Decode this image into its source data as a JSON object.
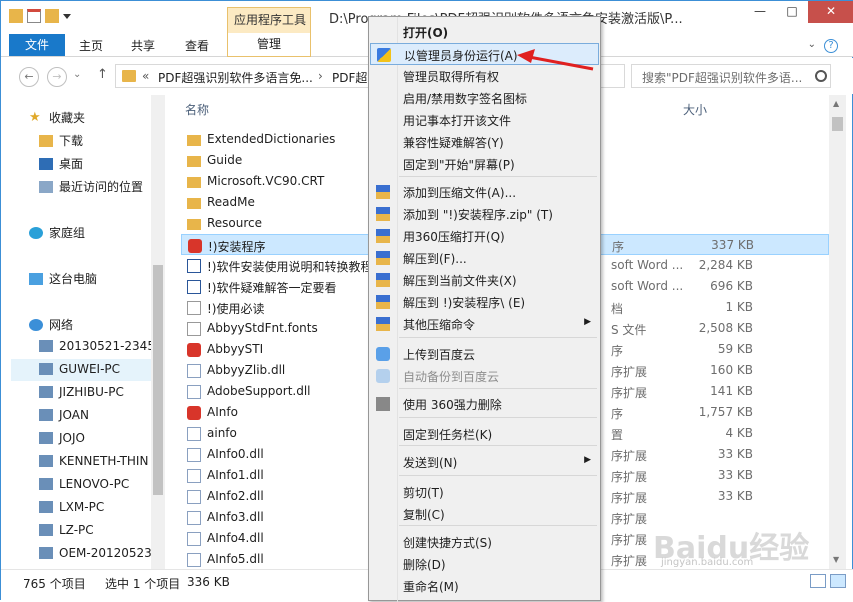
{
  "window": {
    "title": "D:\\Program Files\\PDF超强识别软件多语言免安装激活版\\P...",
    "context_tab_title": "应用程序工具",
    "minimize": "—",
    "maximize": "□",
    "close": "✕"
  },
  "ribbon": {
    "file": "文件",
    "tabs": [
      "主页",
      "共享",
      "查看"
    ],
    "manage": "管理",
    "expand": "⌄",
    "help": "?"
  },
  "address": {
    "back": "←",
    "forward": "→",
    "dropdown": "⌄",
    "up": "↑",
    "overflow": "«",
    "crumbs": [
      "PDF超强识别软件多语言免...",
      "›",
      "PDF超"
    ],
    "search_placeholder": "搜索\"PDF超强识别软件多语..."
  },
  "nav": {
    "favorites": "收藏夹",
    "downloads": "下载",
    "desktop": "桌面",
    "recent": "最近访问的位置",
    "homegroup": "家庭组",
    "this_pc": "这台电脑",
    "network": "网络",
    "computers": [
      "20130521-2345",
      "GUWEI-PC",
      "JIZHIBU-PC",
      "JOAN",
      "JOJO",
      "KENNETH-THIN",
      "LENOVO-PC",
      "LXM-PC",
      "LZ-PC",
      "OEM-20120523"
    ]
  },
  "list": {
    "col_name": "名称",
    "col_size": "大小",
    "rows": [
      {
        "name": "ExtendedDictionaries",
        "type": "",
        "size": "",
        "kind": "folder"
      },
      {
        "name": "Guide",
        "type": "",
        "size": "",
        "kind": "folder"
      },
      {
        "name": "Microsoft.VC90.CRT",
        "type": "",
        "size": "",
        "kind": "folder"
      },
      {
        "name": "ReadMe",
        "type": "",
        "size": "",
        "kind": "folder"
      },
      {
        "name": "Resource",
        "type": "",
        "size": "",
        "kind": "folder"
      },
      {
        "name": "!)安装程序",
        "type": "序",
        "size": "337 KB",
        "kind": "app"
      },
      {
        "name": "!)软件安装使用说明和转换教程",
        "type": "soft Word ...",
        "size": "2,284 KB",
        "kind": "word"
      },
      {
        "name": "!)软件疑难解答一定要看",
        "type": "soft Word ...",
        "size": "696 KB",
        "kind": "word"
      },
      {
        "name": "!)使用必读",
        "type": "档",
        "size": "1 KB",
        "kind": "txt"
      },
      {
        "name": "AbbyyStdFnt.fonts",
        "type": "S 文件",
        "size": "2,508 KB",
        "kind": "file"
      },
      {
        "name": "AbbyySTI",
        "type": "序",
        "size": "59 KB",
        "kind": "app"
      },
      {
        "name": "AbbyyZlib.dll",
        "type": "序扩展",
        "size": "160 KB",
        "kind": "dll"
      },
      {
        "name": "AdobeSupport.dll",
        "type": "序扩展",
        "size": "141 KB",
        "kind": "dll"
      },
      {
        "name": "AInfo",
        "type": "序",
        "size": "1,757 KB",
        "kind": "app"
      },
      {
        "name": "ainfo",
        "type": "置",
        "size": "4 KB",
        "kind": "cfg"
      },
      {
        "name": "AInfo0.dll",
        "type": "序扩展",
        "size": "33 KB",
        "kind": "dll"
      },
      {
        "name": "AInfo1.dll",
        "type": "序扩展",
        "size": "33 KB",
        "kind": "dll"
      },
      {
        "name": "AInfo2.dll",
        "type": "序扩展",
        "size": "33 KB",
        "kind": "dll"
      },
      {
        "name": "AInfo3.dll",
        "type": "序扩展",
        "size": "",
        "kind": "dll"
      },
      {
        "name": "AInfo4.dll",
        "type": "序扩展",
        "size": "",
        "kind": "dll"
      },
      {
        "name": "AInfo5.dll",
        "type": "序扩展",
        "size": "",
        "kind": "dll"
      }
    ]
  },
  "status": {
    "count": "765 个项目",
    "selected": "选中 1 个项目",
    "size": "336 KB"
  },
  "menu": {
    "items": [
      {
        "label": "打开(O)",
        "bold": true
      },
      {
        "label": "以管理员身份运行(A)",
        "highlight": true,
        "icon": "shield-icon"
      },
      {
        "label": "管理员取得所有权"
      },
      {
        "label": "启用/禁用数字签名图标"
      },
      {
        "label": "用记事本打开该文件"
      },
      {
        "label": "兼容性疑难解答(Y)"
      },
      {
        "label": "固定到\"开始\"屏幕(P)"
      },
      {
        "label": "添加到压缩文件(A)...",
        "icon": "archive-icon"
      },
      {
        "label": "添加到 \"!)安装程序.zip\" (T)",
        "icon": "archive-icon"
      },
      {
        "label": "用360压缩打开(Q)",
        "icon": "archive-icon"
      },
      {
        "label": "解压到(F)...",
        "icon": "archive-icon"
      },
      {
        "label": "解压到当前文件夹(X)",
        "icon": "archive-icon"
      },
      {
        "label": "解压到 !)安装程序\\ (E)",
        "icon": "archive-icon"
      },
      {
        "label": "其他压缩命令",
        "icon": "archive-icon",
        "submenu": true
      },
      {
        "label": "上传到百度云",
        "icon": "cloud-icon"
      },
      {
        "label": "自动备份到百度云",
        "disabled": true,
        "icon": "cloud-icon"
      },
      {
        "label": "使用 360强力删除",
        "icon": "shredder-icon"
      },
      {
        "label": "固定到任务栏(K)"
      },
      {
        "label": "发送到(N)",
        "submenu": true
      },
      {
        "label": "剪切(T)"
      },
      {
        "label": "复制(C)"
      },
      {
        "label": "创建快捷方式(S)"
      },
      {
        "label": "删除(D)"
      },
      {
        "label": "重命名(M)"
      }
    ]
  },
  "watermark": {
    "brand": "Baidu经验",
    "url": "jingyan.baidu.com"
  },
  "colors": {
    "accent": "#1979ca",
    "selection": "#cce8ff",
    "menu_highlight": "#dcecfc",
    "arrow": "#e02020"
  }
}
